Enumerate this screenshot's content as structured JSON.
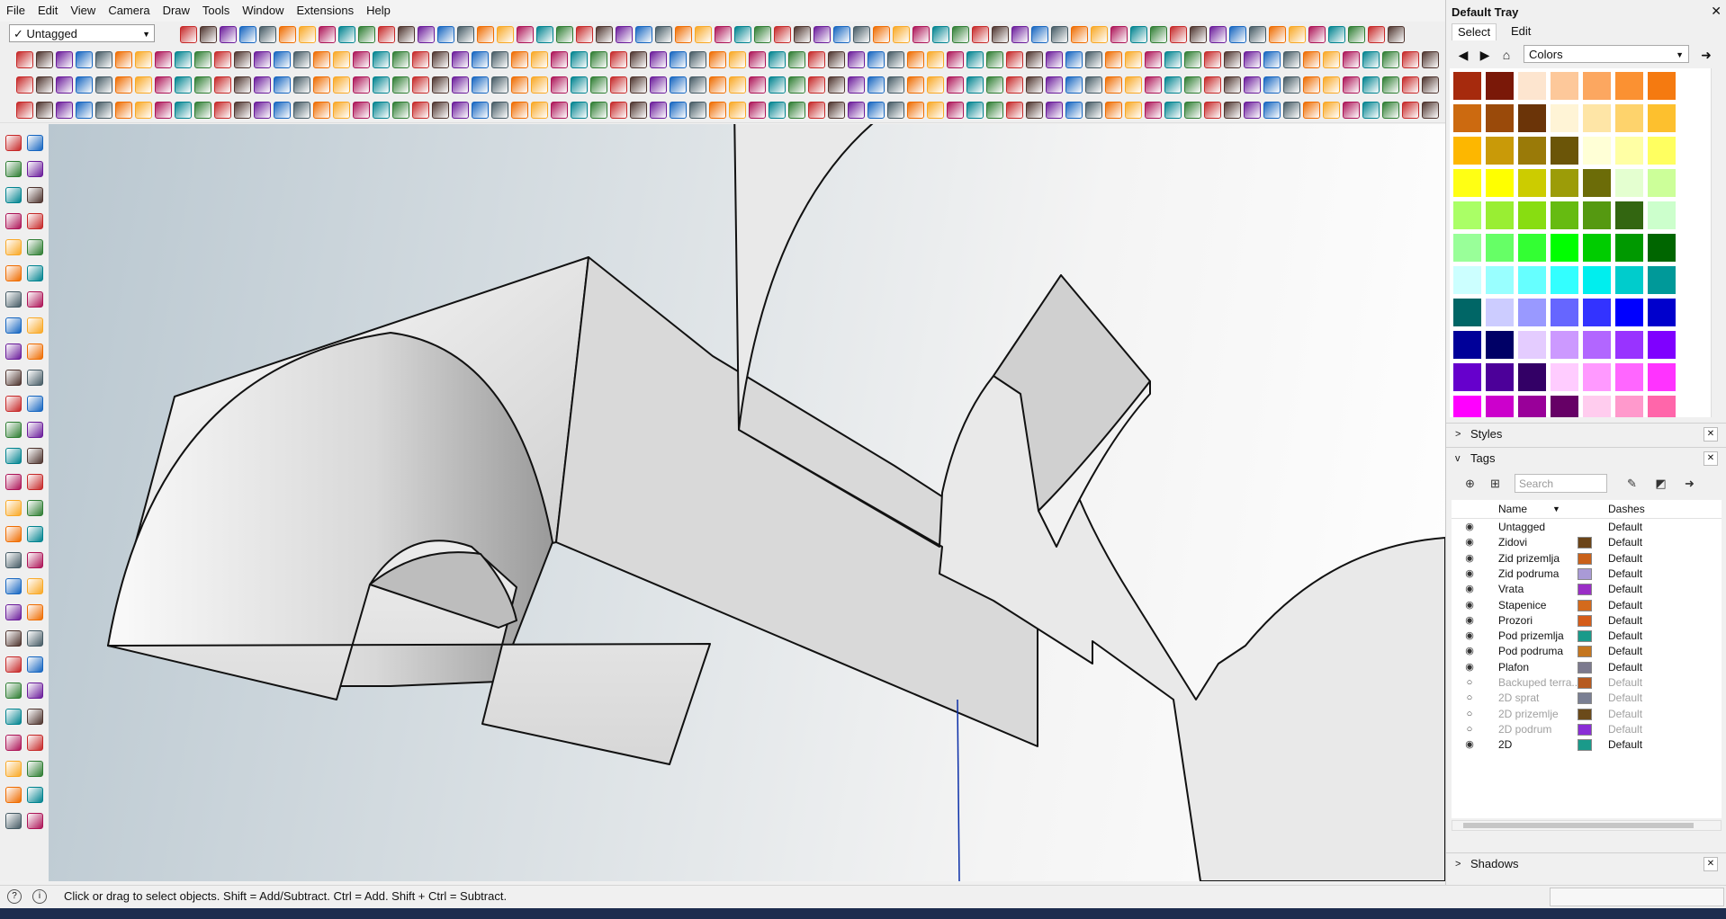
{
  "menu": [
    "File",
    "Edit",
    "View",
    "Camera",
    "Draw",
    "Tools",
    "Window",
    "Extensions",
    "Help"
  ],
  "tag_selector": {
    "value": "Untagged",
    "check": "✓"
  },
  "status_text": "Click or drag to select objects. Shift = Add/Subtract. Ctrl = Add. Shift + Ctrl = Subtract.",
  "status_icons": [
    "?",
    "i"
  ],
  "tray": {
    "title": "Default Tray",
    "close": "✕",
    "colors": {
      "tabs": [
        "Select",
        "Edit"
      ],
      "library": "Colors",
      "swatches": [
        "#a62a0d",
        "#7a1808",
        "#fde5cf",
        "#fdc89a",
        "#fca760",
        "#fb9132",
        "#f57a10",
        "#cc6a10",
        "#9a4a0a",
        "#6b3408",
        "#fff4d6",
        "#fee5a6",
        "#fed36c",
        "#fdc02e",
        "#fdb700",
        "#c99a08",
        "#9a7a08",
        "#6b5508",
        "#ffffd6",
        "#ffffa4",
        "#ffff60",
        "#ffff14",
        "#ffff00",
        "#cccc00",
        "#9c9c08",
        "#6c6c08",
        "#e4ffd0",
        "#ccff99",
        "#aaff66",
        "#99ee33",
        "#88dd11",
        "#66bb11",
        "#559911",
        "#336611",
        "#ccffcc",
        "#99ff99",
        "#66ff66",
        "#33ff33",
        "#00ff00",
        "#00cc00",
        "#009900",
        "#006600",
        "#ccffff",
        "#99ffff",
        "#66ffff",
        "#33ffff",
        "#00eeee",
        "#00cccc",
        "#009999",
        "#006666",
        "#ccccff",
        "#9999ff",
        "#6666ff",
        "#3333ff",
        "#0000ff",
        "#0000cc",
        "#000099",
        "#000066",
        "#e4ccff",
        "#cc99ff",
        "#b266ff",
        "#9933ff",
        "#7f00ff",
        "#6600cc",
        "#4c0099",
        "#330066",
        "#ffccff",
        "#ff99ff",
        "#ff66ff",
        "#ff33ff",
        "#ff00ff",
        "#cc00cc",
        "#990099",
        "#660066",
        "#ffccee",
        "#ff99cc",
        "#ff66aa"
      ]
    },
    "styles_label": "Styles",
    "tags_label": "Tags",
    "shadows_label": "Shadows",
    "search_placeholder": "Search",
    "tag_columns": {
      "name": "Name",
      "dashes": "Dashes"
    },
    "tags": [
      {
        "name": "Untagged",
        "color": "",
        "dashes": "Default",
        "visible": true
      },
      {
        "name": "Zidovi",
        "color": "#6b4418",
        "dashes": "Default",
        "visible": true
      },
      {
        "name": "Zid prizemlja",
        "color": "#c9611a",
        "dashes": "Default",
        "visible": true
      },
      {
        "name": "Zid podruma",
        "color": "#a99ad6",
        "dashes": "Default",
        "visible": true
      },
      {
        "name": "Vrata",
        "color": "#9a2ec6",
        "dashes": "Default",
        "visible": true
      },
      {
        "name": "Stapenice",
        "color": "#d46a1c",
        "dashes": "Default",
        "visible": true
      },
      {
        "name": "Prozori",
        "color": "#d55d1a",
        "dashes": "Default",
        "visible": true
      },
      {
        "name": "Pod prizemlja",
        "color": "#1a9a8a",
        "dashes": "Default",
        "visible": true
      },
      {
        "name": "Pod podruma",
        "color": "#c4761f",
        "dashes": "Default",
        "visible": true
      },
      {
        "name": "Plafon",
        "color": "#7c7a8e",
        "dashes": "Default",
        "visible": true
      },
      {
        "name": "Backuped terra...",
        "color": "#b65a20",
        "dashes": "Default",
        "visible": false
      },
      {
        "name": "2D sprat",
        "color": "#7a7f93",
        "dashes": "Default",
        "visible": false
      },
      {
        "name": "2D prizemlje",
        "color": "#6b4a1a",
        "dashes": "Default",
        "visible": false
      },
      {
        "name": "2D podrum",
        "color": "#8a2ed6",
        "dashes": "Default",
        "visible": false
      },
      {
        "name": "2D",
        "color": "#1a9a8a",
        "dashes": "Default",
        "visible": true
      }
    ]
  },
  "toolbar_palette": [
    "#c62828",
    "#1565c0",
    "#f9a825",
    "#2e7d32",
    "#6a1b9a",
    "#ef6c00",
    "#00838f",
    "#4e342e",
    "#455a64",
    "#ad1457"
  ]
}
